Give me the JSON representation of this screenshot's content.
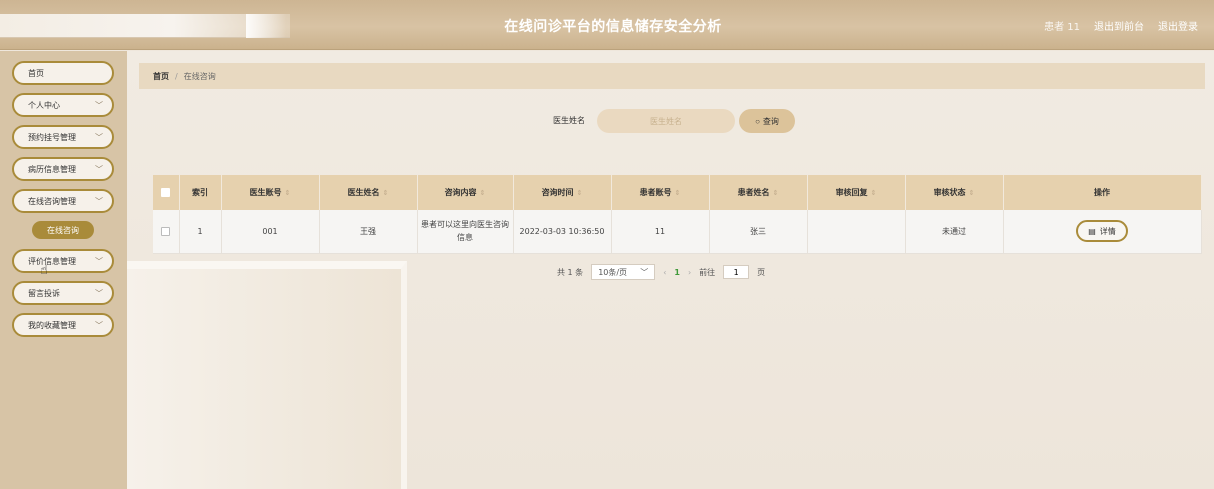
{
  "header": {
    "title": "在线问诊平台的信息储存安全分析",
    "user": "患者 11",
    "back_link": "退出到前台",
    "logout_link": "退出登录"
  },
  "sidebar": {
    "items": [
      {
        "label": "首页",
        "chevron": false
      },
      {
        "label": "个人中心",
        "chevron": true
      },
      {
        "label": "预约挂号管理",
        "chevron": true
      },
      {
        "label": "病历信息管理",
        "chevron": true
      },
      {
        "label": "在线咨询管理",
        "chevron": true
      },
      {
        "label": "评价信息管理",
        "chevron": true
      },
      {
        "label": "留言投诉",
        "chevron": true
      },
      {
        "label": "我的收藏管理",
        "chevron": true
      }
    ],
    "active_sub": "在线咨询"
  },
  "breadcrumb": {
    "home": "首页",
    "separator": "/",
    "current": "在线咨询"
  },
  "search": {
    "label": "医生姓名",
    "placeholder": "医生姓名",
    "button": "查询"
  },
  "table": {
    "columns": [
      "索引",
      "医生账号",
      "医生姓名",
      "咨询内容",
      "咨询时间",
      "患者账号",
      "患者姓名",
      "审核回复",
      "审核状态",
      "操作"
    ],
    "rows": [
      {
        "index": "1",
        "doctor_account": "001",
        "doctor_name": "王强",
        "content": "患者可以这里向医生咨询信息",
        "time": "2022-03-03 10:36:50",
        "patient_account": "11",
        "patient_name": "张三",
        "reply": "",
        "status": "未通过",
        "action": "详情"
      }
    ]
  },
  "pagination": {
    "total": "共 1 条",
    "page_size": "10条/页",
    "current_page": "1",
    "goto_label": "前往",
    "goto_value": "1",
    "page_suffix": "页"
  }
}
